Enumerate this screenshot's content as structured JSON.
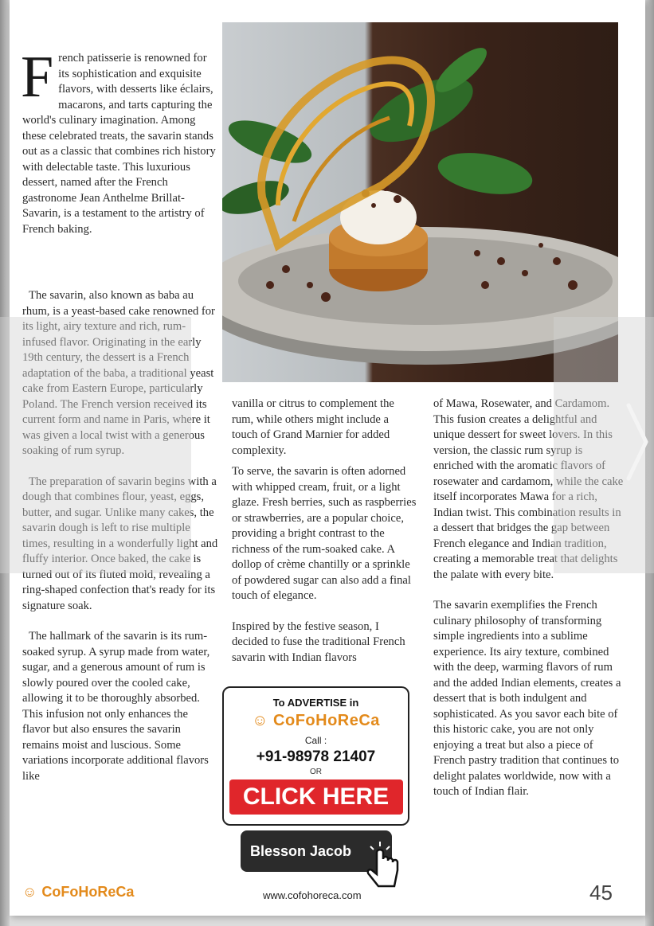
{
  "article": {
    "dropcap": "F",
    "col1": {
      "p1_rest": "rench patisserie is renowned for its sophistication and exquisite flavors, with desserts like éclairs, macarons, and tarts capturing the world's culinary imagination. Among these celebrated treats, the savarin stands out as a classic that combines rich history with delectable taste. This luxurious dessert, named after the French gastronome Jean Anthelme Brillat-Savarin, is a testament to the artistry of French baking.",
      "p2": "The savarin, also known as baba au rhum, is a yeast-based cake renowned for its light, airy texture and rich, rum-infused flavor. Originating in the early 19th century, the dessert is a French adaptation of the baba, a traditional yeast cake from Eastern Europe, particularly Poland. The French version received its current form and name in Paris, where it was given a local twist with a generous soaking of rum syrup.",
      "p3": "The preparation of savarin begins with a dough that combines flour, yeast, eggs, butter, and sugar. Unlike many cakes, the savarin dough is left to rise multiple times, resulting in a wonderfully light and fluffy interior. Once baked, the cake is turned out of its fluted mold, revealing a ring-shaped confection that's ready for its signature soak.",
      "p4": "The hallmark of the savarin is its rum-soaked syrup. A syrup made from water, sugar, and a generous amount of rum is slowly poured over the cooled cake, allowing it to be thoroughly absorbed. This infusion not only enhances the flavor but also ensures the savarin remains moist and luscious. Some variations incorporate additional flavors like"
    },
    "col2": {
      "p1": "vanilla or citrus to complement the rum, while others might include a touch of Grand Marnier for added complexity.",
      "p2": "To serve, the savarin is often adorned with whipped cream, fruit, or a light glaze. Fresh berries, such as raspberries or strawberries, are a popular choice, providing a bright contrast to the richness of the rum-soaked cake. A dollop of crème chantilly or a sprinkle of powdered sugar can also add a final touch of elegance.",
      "p3": "Inspired by the festive season, I decided to fuse the traditional French savarin with Indian flavors"
    },
    "col3": {
      "p1": "of Mawa, Rosewater, and Cardamom. This fusion creates a delightful and unique dessert for sweet lovers. In this version, the classic rum syrup is enriched with the aromatic flavors of rosewater and cardamom, while the cake itself incorporates Mawa for a rich, Indian twist. This combination results in a dessert that bridges the gap between French elegance and Indian tradition, creating a memorable treat that delights the palate with every bite.",
      "p2": "The savarin exemplifies the French culinary philosophy of transforming simple ingredients into a sublime experience. Its airy texture, combined with the deep, warming flavors of rum and the added Indian elements, creates a dessert that is both indulgent and sophisticated. As you savor each bite of this historic cake, you are not only enjoying a treat but also a piece of French pastry tradition that continues to delight palates worldwide, now with a touch of Indian flair."
    }
  },
  "ad": {
    "title": "To ADVERTISE in",
    "brand": "CoFoHoReCa",
    "call_label": "Call :",
    "phone": "+91-98978 21407",
    "or_label": "OR",
    "click_label": "CLICK HERE",
    "contact_button": "Blesson Jacob"
  },
  "footer": {
    "brand": "CoFoHoReCa",
    "url": "www.cofohoreca.com",
    "page_number": "45"
  },
  "colors": {
    "brand_orange": "#e38a1b",
    "click_red": "#e0262b"
  },
  "icons": [
    "brand-smiley-icon",
    "tap-hand-icon",
    "next-page-chevron-icon"
  ]
}
